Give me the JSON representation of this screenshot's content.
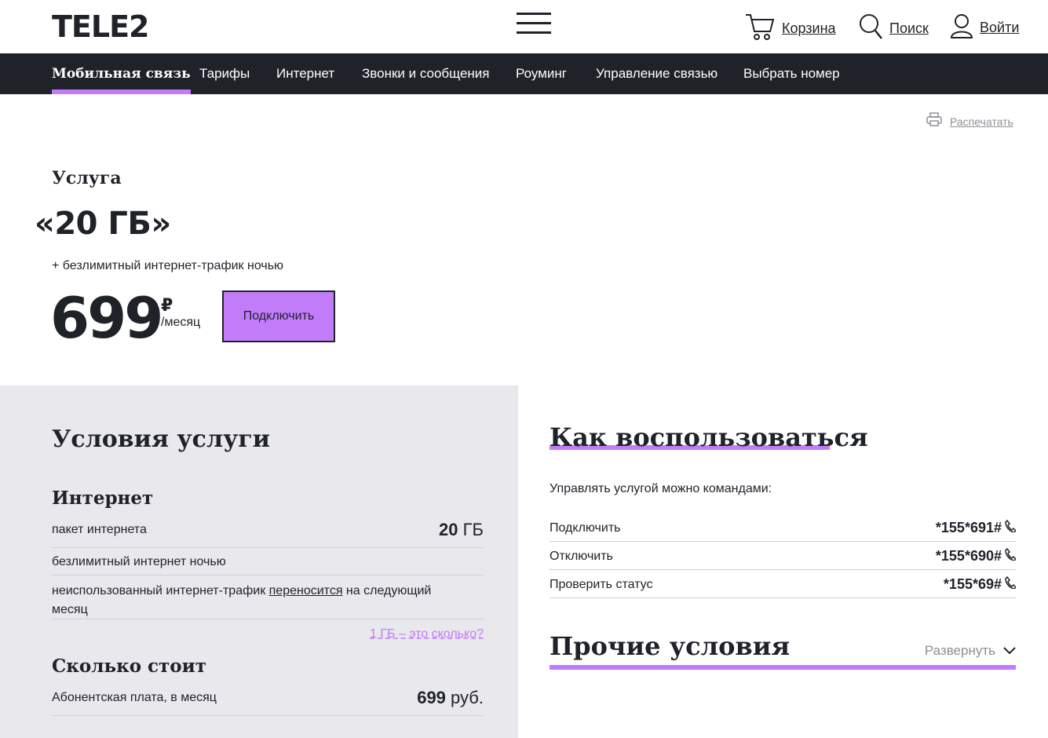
{
  "header": {
    "logo": "TELE2",
    "cart_label": "Корзина",
    "search_label": "Поиск",
    "login_label": "Войти"
  },
  "nav": {
    "items": [
      {
        "label": "Мобильная связь",
        "active": true
      },
      {
        "label": "Тарифы"
      },
      {
        "label": "Интернет"
      },
      {
        "label": "Звонки и сообщения"
      },
      {
        "label": "Роуминг"
      },
      {
        "label": "Управление связью"
      },
      {
        "label": "Выбрать номер"
      }
    ]
  },
  "print_label": "Распечатать",
  "service": {
    "kicker": "Услуга",
    "title": "«20 ГБ»",
    "subtitle": "+ безлимитный интернет-трафик ночью",
    "price": "699",
    "currency": "₽",
    "period": "/месяц",
    "connect_label": "Подключить"
  },
  "conditions": {
    "title": "Условия услуги",
    "internet_heading": "Интернет",
    "package_label": "пакет интернета",
    "package_value_num": "20",
    "package_value_unit": "ГБ",
    "night_label": "безлимитный интернет ночью",
    "carry_pre": "неиспользованный интернет-трафик ",
    "carry_link": "переносится",
    "carry_post": " на следующий месяц",
    "gb_link": "1 ГБ – это сколько?",
    "cost_heading": "Сколько стоит",
    "fee_label": "Абонентская плата, в месяц",
    "fee_value_num": "699",
    "fee_value_unit": "руб."
  },
  "howto": {
    "title": "Как воспользоваться",
    "intro": "Управлять услугой можно командами:",
    "commands": [
      {
        "name": "Подключить",
        "code": "*155*691#"
      },
      {
        "name": "Отключить",
        "code": "*155*690#"
      },
      {
        "name": "Проверить статус",
        "code": "*155*69#"
      }
    ],
    "other_title": "Прочие условия",
    "expand_label": "Развернуть"
  },
  "colors": {
    "accent": "#c27cfa",
    "dark": "#1f2229",
    "panel": "#e8e8ed"
  }
}
